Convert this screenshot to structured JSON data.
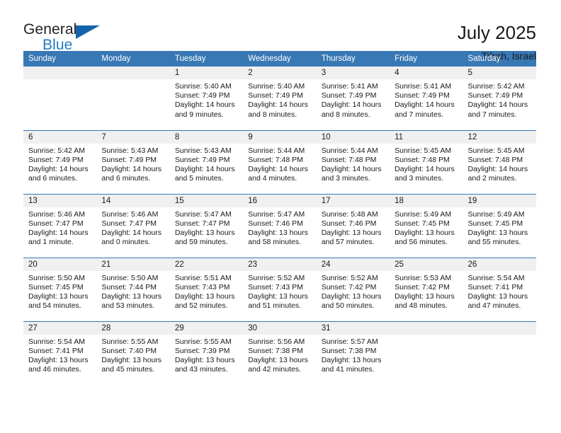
{
  "brand": {
    "name_top": "General",
    "name_bottom": "Blue",
    "accent_color": "#1f7bc4",
    "triangle_color": "#1464ab"
  },
  "header": {
    "title": "July 2025",
    "subtitle": "Tifrah, Israel"
  },
  "calendar": {
    "header_bg": "#3878b4",
    "daynum_bg": "#f0f0f0",
    "weekday_names": [
      "Sunday",
      "Monday",
      "Tuesday",
      "Wednesday",
      "Thursday",
      "Friday",
      "Saturday"
    ],
    "weeks": [
      [
        {
          "day": "",
          "empty": true
        },
        {
          "day": "",
          "empty": true
        },
        {
          "day": "1",
          "sunrise": "Sunrise: 5:40 AM",
          "sunset": "Sunset: 7:49 PM",
          "daylight": "Daylight: 14 hours and 9 minutes."
        },
        {
          "day": "2",
          "sunrise": "Sunrise: 5:40 AM",
          "sunset": "Sunset: 7:49 PM",
          "daylight": "Daylight: 14 hours and 8 minutes."
        },
        {
          "day": "3",
          "sunrise": "Sunrise: 5:41 AM",
          "sunset": "Sunset: 7:49 PM",
          "daylight": "Daylight: 14 hours and 8 minutes."
        },
        {
          "day": "4",
          "sunrise": "Sunrise: 5:41 AM",
          "sunset": "Sunset: 7:49 PM",
          "daylight": "Daylight: 14 hours and 7 minutes."
        },
        {
          "day": "5",
          "sunrise": "Sunrise: 5:42 AM",
          "sunset": "Sunset: 7:49 PM",
          "daylight": "Daylight: 14 hours and 7 minutes."
        }
      ],
      [
        {
          "day": "6",
          "sunrise": "Sunrise: 5:42 AM",
          "sunset": "Sunset: 7:49 PM",
          "daylight": "Daylight: 14 hours and 6 minutes."
        },
        {
          "day": "7",
          "sunrise": "Sunrise: 5:43 AM",
          "sunset": "Sunset: 7:49 PM",
          "daylight": "Daylight: 14 hours and 6 minutes."
        },
        {
          "day": "8",
          "sunrise": "Sunrise: 5:43 AM",
          "sunset": "Sunset: 7:49 PM",
          "daylight": "Daylight: 14 hours and 5 minutes."
        },
        {
          "day": "9",
          "sunrise": "Sunrise: 5:44 AM",
          "sunset": "Sunset: 7:48 PM",
          "daylight": "Daylight: 14 hours and 4 minutes."
        },
        {
          "day": "10",
          "sunrise": "Sunrise: 5:44 AM",
          "sunset": "Sunset: 7:48 PM",
          "daylight": "Daylight: 14 hours and 3 minutes."
        },
        {
          "day": "11",
          "sunrise": "Sunrise: 5:45 AM",
          "sunset": "Sunset: 7:48 PM",
          "daylight": "Daylight: 14 hours and 3 minutes."
        },
        {
          "day": "12",
          "sunrise": "Sunrise: 5:45 AM",
          "sunset": "Sunset: 7:48 PM",
          "daylight": "Daylight: 14 hours and 2 minutes."
        }
      ],
      [
        {
          "day": "13",
          "sunrise": "Sunrise: 5:46 AM",
          "sunset": "Sunset: 7:47 PM",
          "daylight": "Daylight: 14 hours and 1 minute."
        },
        {
          "day": "14",
          "sunrise": "Sunrise: 5:46 AM",
          "sunset": "Sunset: 7:47 PM",
          "daylight": "Daylight: 14 hours and 0 minutes."
        },
        {
          "day": "15",
          "sunrise": "Sunrise: 5:47 AM",
          "sunset": "Sunset: 7:47 PM",
          "daylight": "Daylight: 13 hours and 59 minutes."
        },
        {
          "day": "16",
          "sunrise": "Sunrise: 5:47 AM",
          "sunset": "Sunset: 7:46 PM",
          "daylight": "Daylight: 13 hours and 58 minutes."
        },
        {
          "day": "17",
          "sunrise": "Sunrise: 5:48 AM",
          "sunset": "Sunset: 7:46 PM",
          "daylight": "Daylight: 13 hours and 57 minutes."
        },
        {
          "day": "18",
          "sunrise": "Sunrise: 5:49 AM",
          "sunset": "Sunset: 7:45 PM",
          "daylight": "Daylight: 13 hours and 56 minutes."
        },
        {
          "day": "19",
          "sunrise": "Sunrise: 5:49 AM",
          "sunset": "Sunset: 7:45 PM",
          "daylight": "Daylight: 13 hours and 55 minutes."
        }
      ],
      [
        {
          "day": "20",
          "sunrise": "Sunrise: 5:50 AM",
          "sunset": "Sunset: 7:45 PM",
          "daylight": "Daylight: 13 hours and 54 minutes."
        },
        {
          "day": "21",
          "sunrise": "Sunrise: 5:50 AM",
          "sunset": "Sunset: 7:44 PM",
          "daylight": "Daylight: 13 hours and 53 minutes."
        },
        {
          "day": "22",
          "sunrise": "Sunrise: 5:51 AM",
          "sunset": "Sunset: 7:43 PM",
          "daylight": "Daylight: 13 hours and 52 minutes."
        },
        {
          "day": "23",
          "sunrise": "Sunrise: 5:52 AM",
          "sunset": "Sunset: 7:43 PM",
          "daylight": "Daylight: 13 hours and 51 minutes."
        },
        {
          "day": "24",
          "sunrise": "Sunrise: 5:52 AM",
          "sunset": "Sunset: 7:42 PM",
          "daylight": "Daylight: 13 hours and 50 minutes."
        },
        {
          "day": "25",
          "sunrise": "Sunrise: 5:53 AM",
          "sunset": "Sunset: 7:42 PM",
          "daylight": "Daylight: 13 hours and 48 minutes."
        },
        {
          "day": "26",
          "sunrise": "Sunrise: 5:54 AM",
          "sunset": "Sunset: 7:41 PM",
          "daylight": "Daylight: 13 hours and 47 minutes."
        }
      ],
      [
        {
          "day": "27",
          "sunrise": "Sunrise: 5:54 AM",
          "sunset": "Sunset: 7:41 PM",
          "daylight": "Daylight: 13 hours and 46 minutes."
        },
        {
          "day": "28",
          "sunrise": "Sunrise: 5:55 AM",
          "sunset": "Sunset: 7:40 PM",
          "daylight": "Daylight: 13 hours and 45 minutes."
        },
        {
          "day": "29",
          "sunrise": "Sunrise: 5:55 AM",
          "sunset": "Sunset: 7:39 PM",
          "daylight": "Daylight: 13 hours and 43 minutes."
        },
        {
          "day": "30",
          "sunrise": "Sunrise: 5:56 AM",
          "sunset": "Sunset: 7:38 PM",
          "daylight": "Daylight: 13 hours and 42 minutes."
        },
        {
          "day": "31",
          "sunrise": "Sunrise: 5:57 AM",
          "sunset": "Sunset: 7:38 PM",
          "daylight": "Daylight: 13 hours and 41 minutes."
        },
        {
          "day": "",
          "empty": true
        },
        {
          "day": "",
          "empty": true
        }
      ]
    ]
  }
}
